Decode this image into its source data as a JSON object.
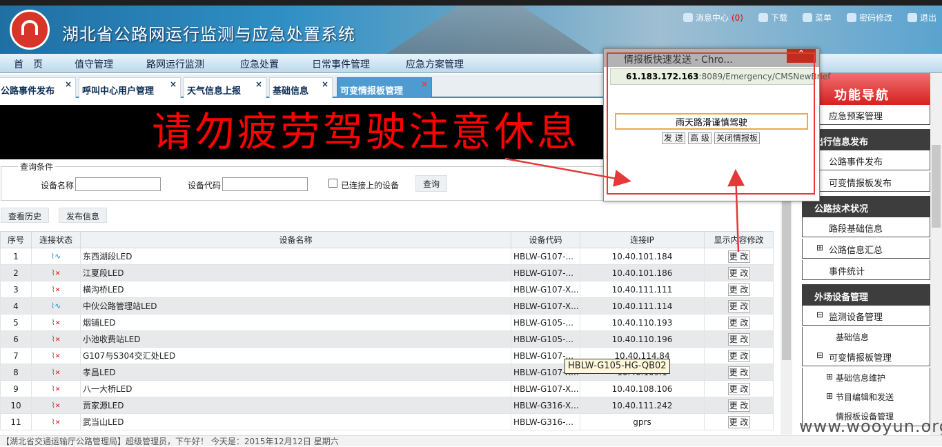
{
  "header": {
    "title": "湖北省公路网运行监测与应急处置系统",
    "links": [
      {
        "label": "消息中心",
        "count": "(0)"
      },
      {
        "label": "下载"
      },
      {
        "label": "菜单"
      },
      {
        "label": "密码修改"
      },
      {
        "label": "退出"
      }
    ]
  },
  "nav": [
    "首　页",
    "值守管理",
    "路网运行监测",
    "应急处置",
    "日常事件管理",
    "应急方案管理"
  ],
  "tabs": [
    "公路事件发布",
    "呼叫中心用户管理",
    "天气信息上报",
    "基础信息",
    "可变情报板管理"
  ],
  "banner_text": "请勿疲劳驾驶注意休息",
  "query": {
    "legend": "查询条件",
    "device_name_label": "设备名称",
    "device_code_label": "设备代码",
    "connected_label": "已连接上的设备",
    "query_button": "查询",
    "history_button": "查看历史",
    "publish_button": "发布信息"
  },
  "table": {
    "headers": [
      "序号",
      "连接状态",
      "设备名称",
      "设备代码",
      "连接IP",
      "显示内容修改"
    ],
    "update_label": "更 改",
    "rows": [
      {
        "no": "1",
        "status": "on",
        "name": "东西湖段LED",
        "code": "HBLW-G107-...",
        "ip": "10.40.101.184"
      },
      {
        "no": "2",
        "status": "off",
        "name": "江夏段LED",
        "code": "HBLW-G107-...",
        "ip": "10.40.101.186"
      },
      {
        "no": "3",
        "status": "off",
        "name": "横沟桥LED",
        "code": "HBLW-G107-X...",
        "ip": "10.40.111.111"
      },
      {
        "no": "4",
        "status": "on",
        "name": "中伙公路管理站LED",
        "code": "HBLW-G107-X...",
        "ip": "10.40.111.114"
      },
      {
        "no": "5",
        "status": "off",
        "name": "烟铺LED",
        "code": "HBLW-G105-...",
        "ip": "10.40.110.193"
      },
      {
        "no": "6",
        "status": "off",
        "name": "小池收费站LED",
        "code": "HBLW-G105-...",
        "ip": "10.40.110.196"
      },
      {
        "no": "7",
        "status": "off",
        "name": "G107与S304交汇处LED",
        "code": "HBLW-G107-...",
        "ip": "10.40.114.84"
      },
      {
        "no": "8",
        "status": "off",
        "name": "孝昌LED",
        "code": "HBLW-G107-X...",
        "ip": "10.40.109.1"
      },
      {
        "no": "9",
        "status": "off",
        "name": "八一大桥LED",
        "code": "HBLW-G107-X...",
        "ip": "10.40.108.106"
      },
      {
        "no": "10",
        "status": "off",
        "name": "贾家源LED",
        "code": "HBLW-G316-X...",
        "ip": "10.40.111.242"
      },
      {
        "no": "11",
        "status": "off",
        "name": "武当山LED",
        "code": "HBLW-G316-...",
        "ip": "gprs"
      }
    ]
  },
  "tooltip": "HBLW-G105-HG-QB02",
  "status_bar": "【湖北省交通运输厅公路管理局】超级管理员，下午好！ 今天是：2015年12月12日 星期六",
  "sidebar": {
    "heading": "功能导航",
    "items": [
      {
        "type": "item",
        "label": "应急预案管理"
      },
      {
        "type": "group",
        "label": "出行信息发布"
      },
      {
        "type": "item",
        "label": "公路事件发布"
      },
      {
        "type": "item",
        "label": "可变情报板发布"
      },
      {
        "type": "group",
        "label": "公路技术状况"
      },
      {
        "type": "item",
        "label": "路段基础信息"
      },
      {
        "type": "item",
        "label": "公路信息汇总",
        "toggle": "⊞"
      },
      {
        "type": "item",
        "label": "事件统计"
      },
      {
        "type": "group",
        "label": "外场设备管理"
      },
      {
        "type": "item",
        "label": "监测设备管理",
        "toggle": "⊟"
      },
      {
        "type": "sub",
        "label": "基础信息"
      },
      {
        "type": "item",
        "label": "可变情报板管理",
        "toggle": "⊟"
      },
      {
        "type": "sub",
        "label": "基础信息维护",
        "toggle": "⊞"
      },
      {
        "type": "sub",
        "label": "节目编辑和发送",
        "toggle": "⊞"
      },
      {
        "type": "sub",
        "label": "情报板设备管理"
      }
    ]
  },
  "popup": {
    "title": "情报板快速发送 - Chro...",
    "url_host": "61.183.172.163",
    "url_rest": ":8089/Emergency/CMSNewBrief",
    "input_value": "雨天路滑谨慎驾驶",
    "buttons": [
      "发 送",
      "高 级",
      "关闭情报板"
    ]
  },
  "watermark": "www.wooyun.org",
  "colors": {
    "accent": "#3b8cc0",
    "highlight": "#e53838",
    "banner_text": "#ff0000"
  }
}
